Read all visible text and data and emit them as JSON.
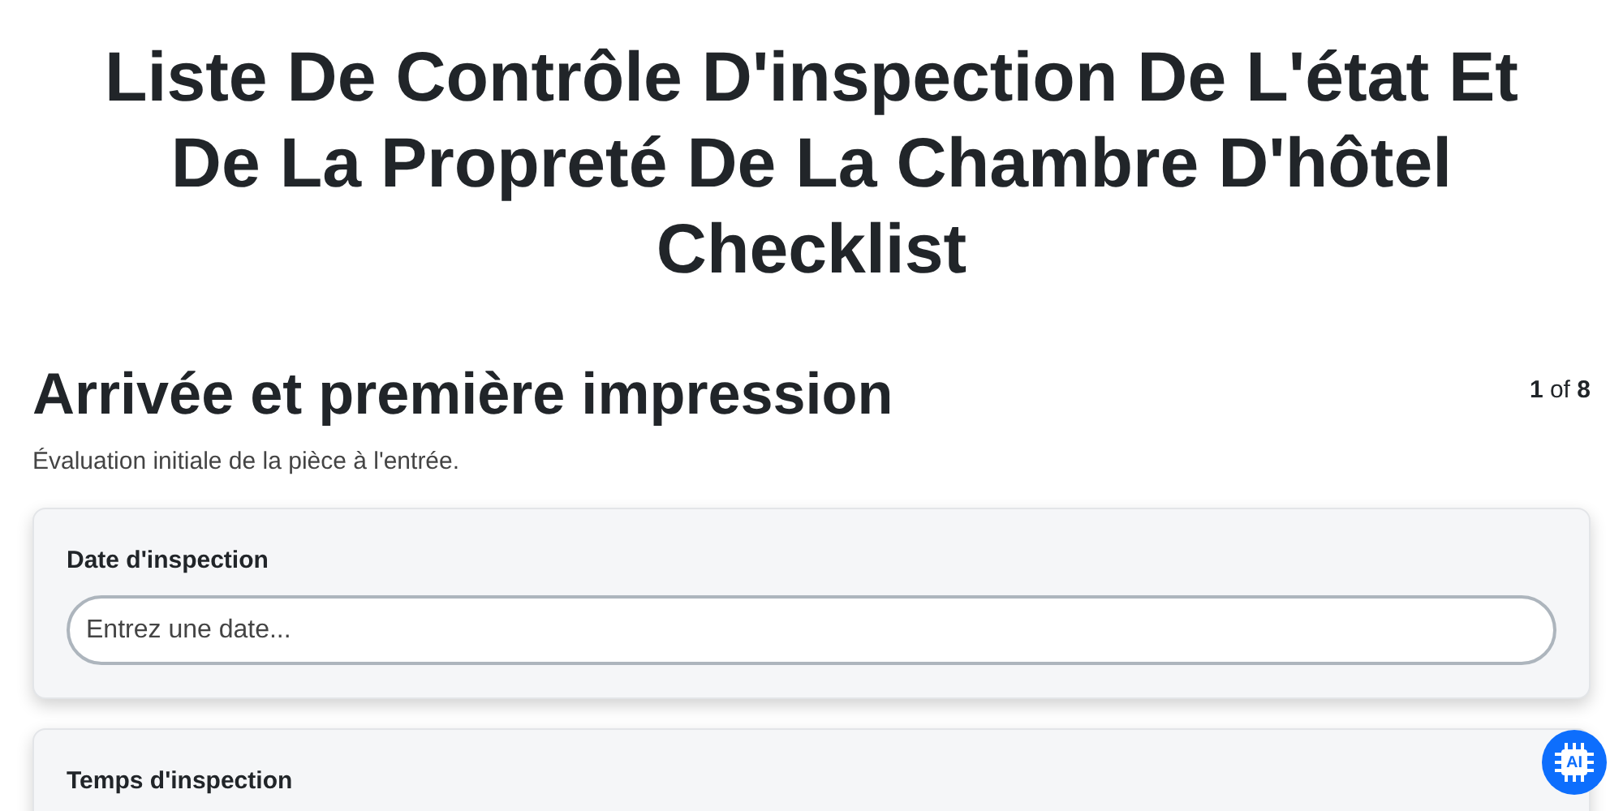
{
  "title": "Liste De Contrôle D'inspection De L'état Et De La Propreté De La Chambre D'hôtel Checklist",
  "section": {
    "heading": "Arrivée et première impression",
    "progress": "**1** of **8**",
    "description": "Évaluation initiale de la pièce à l'entrée."
  },
  "fields": [
    {
      "label": "Date d'inspection",
      "placeholder": "Entrez une date..."
    },
    {
      "label": "Temps d'inspection"
    }
  ],
  "assistant_button": {
    "label": "AI"
  }
}
